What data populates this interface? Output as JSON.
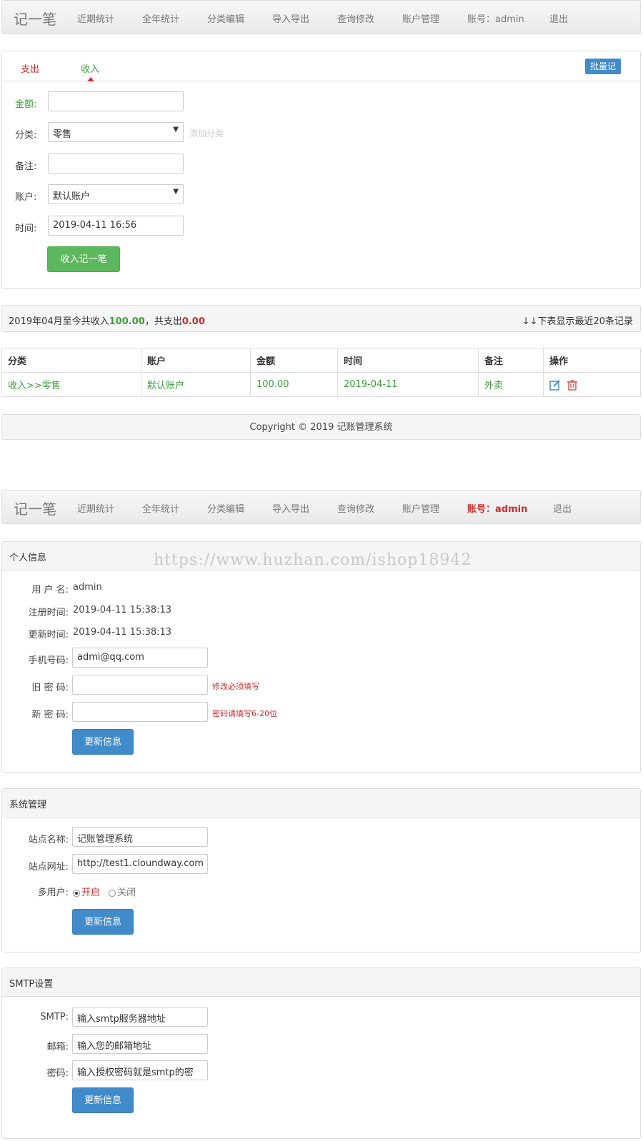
{
  "nav": {
    "brand": "记一笔",
    "items": [
      "近期统计",
      "全年统计",
      "分类编辑",
      "导入导出",
      "查询修改",
      "账户管理"
    ],
    "account": "账号：admin",
    "logout": "退出"
  },
  "record_form": {
    "tab_expense": "支出",
    "tab_income": "收入",
    "batch_button": "批量记",
    "amount_label": "金额:",
    "amount_value": "",
    "category_label": "分类:",
    "category_value": "零售",
    "add_category_link": "添加分类",
    "note_label": "备注:",
    "note_value": "",
    "account_label": "账户:",
    "account_value": "默认账户",
    "time_label": "时间:",
    "time_value": "2019-04-11 16:56",
    "submit_label": "收入记一笔"
  },
  "summary": {
    "prefix": "2019年04月至今共收入",
    "income": "100.00",
    "middle": "，共支出",
    "expense": "0.00",
    "right_note": "↓↓下表显示最近20条记录"
  },
  "table": {
    "headers": [
      "分类",
      "账户",
      "金额",
      "时间",
      "备注",
      "操作"
    ],
    "rows": [
      [
        "收入>>零售",
        "默认账户",
        "100.00",
        "2019-04-11",
        "外卖"
      ]
    ]
  },
  "footer": {
    "text": "Copyright © 2019 记账管理系统"
  },
  "watermark": "https://www.huzhan.com/ishop18942",
  "personal": {
    "heading": "个人信息",
    "username_label": "用 户 名:",
    "username_value": "admin",
    "reg_label": "注册时间:",
    "reg_value": "2019-04-11 15:38:13",
    "upd_label": "更新时间:",
    "upd_value": "2019-04-11 15:38:13",
    "phone_label": "手机号码:",
    "phone_value": "admi@qq.com",
    "old_pwd_label": "旧 密 码:",
    "old_pwd_hint": "修改必须填写",
    "new_pwd_label": "新 密 码:",
    "new_pwd_hint": "密码请填写6-20位",
    "update_button": "更新信息"
  },
  "system": {
    "heading": "系统管理",
    "site_name_label": "站点名称:",
    "site_name_value": "记账管理系统",
    "site_url_label": "站点网址:",
    "site_url_value": "http://test1.cloundway.com",
    "multi_user_label": "多用户:",
    "opt_on": "开启",
    "opt_off": "关闭",
    "update_button": "更新信息"
  },
  "smtp": {
    "heading": "SMTP设置",
    "smtp_label": "SMTP:",
    "smtp_placeholder": "输入smtp服务器地址",
    "mail_label": "邮箱:",
    "mail_placeholder": "输入您的邮箱地址",
    "pwd_label": "密码:",
    "pwd_placeholder": "输入授权密码就是smtp的密",
    "update_button": "更新信息"
  },
  "colors": {
    "income_green": "#3c9d3c",
    "expense_red": "#c9302c",
    "primary_blue": "#428bca",
    "success_green": "#5cb85c"
  }
}
